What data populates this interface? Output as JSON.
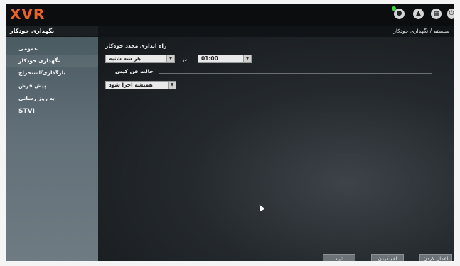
{
  "app": {
    "logo": "XVR"
  },
  "header": {
    "sidebar_title": "نگهداری خودکار",
    "breadcrumb": "سیستم / نگهداری خودکار"
  },
  "toolbar": {
    "icons": [
      "live-view-icon",
      "alarm-icon",
      "menu-grid-icon",
      "power-icon"
    ]
  },
  "sidebar": {
    "items": [
      {
        "label": "عمومی"
      },
      {
        "label": "نگهداری خودکار"
      },
      {
        "label": "بارگذاری/استخراج"
      },
      {
        "label": "پیش فرض"
      },
      {
        "label": "به روز رسانی"
      },
      {
        "label": "STVI"
      }
    ]
  },
  "main": {
    "reboot_section": "راه اندازی مجدد خودکار",
    "day_value": "هر سه شنبه",
    "at_label": "در",
    "time_value": "01:00",
    "case_fan_section": "حالت فن کیس",
    "fan_value": "همیشه اجرا شود"
  },
  "buttons": {
    "apply": "اعمال کردن",
    "cancel": "لغو کردن",
    "ok": "تایید"
  }
}
